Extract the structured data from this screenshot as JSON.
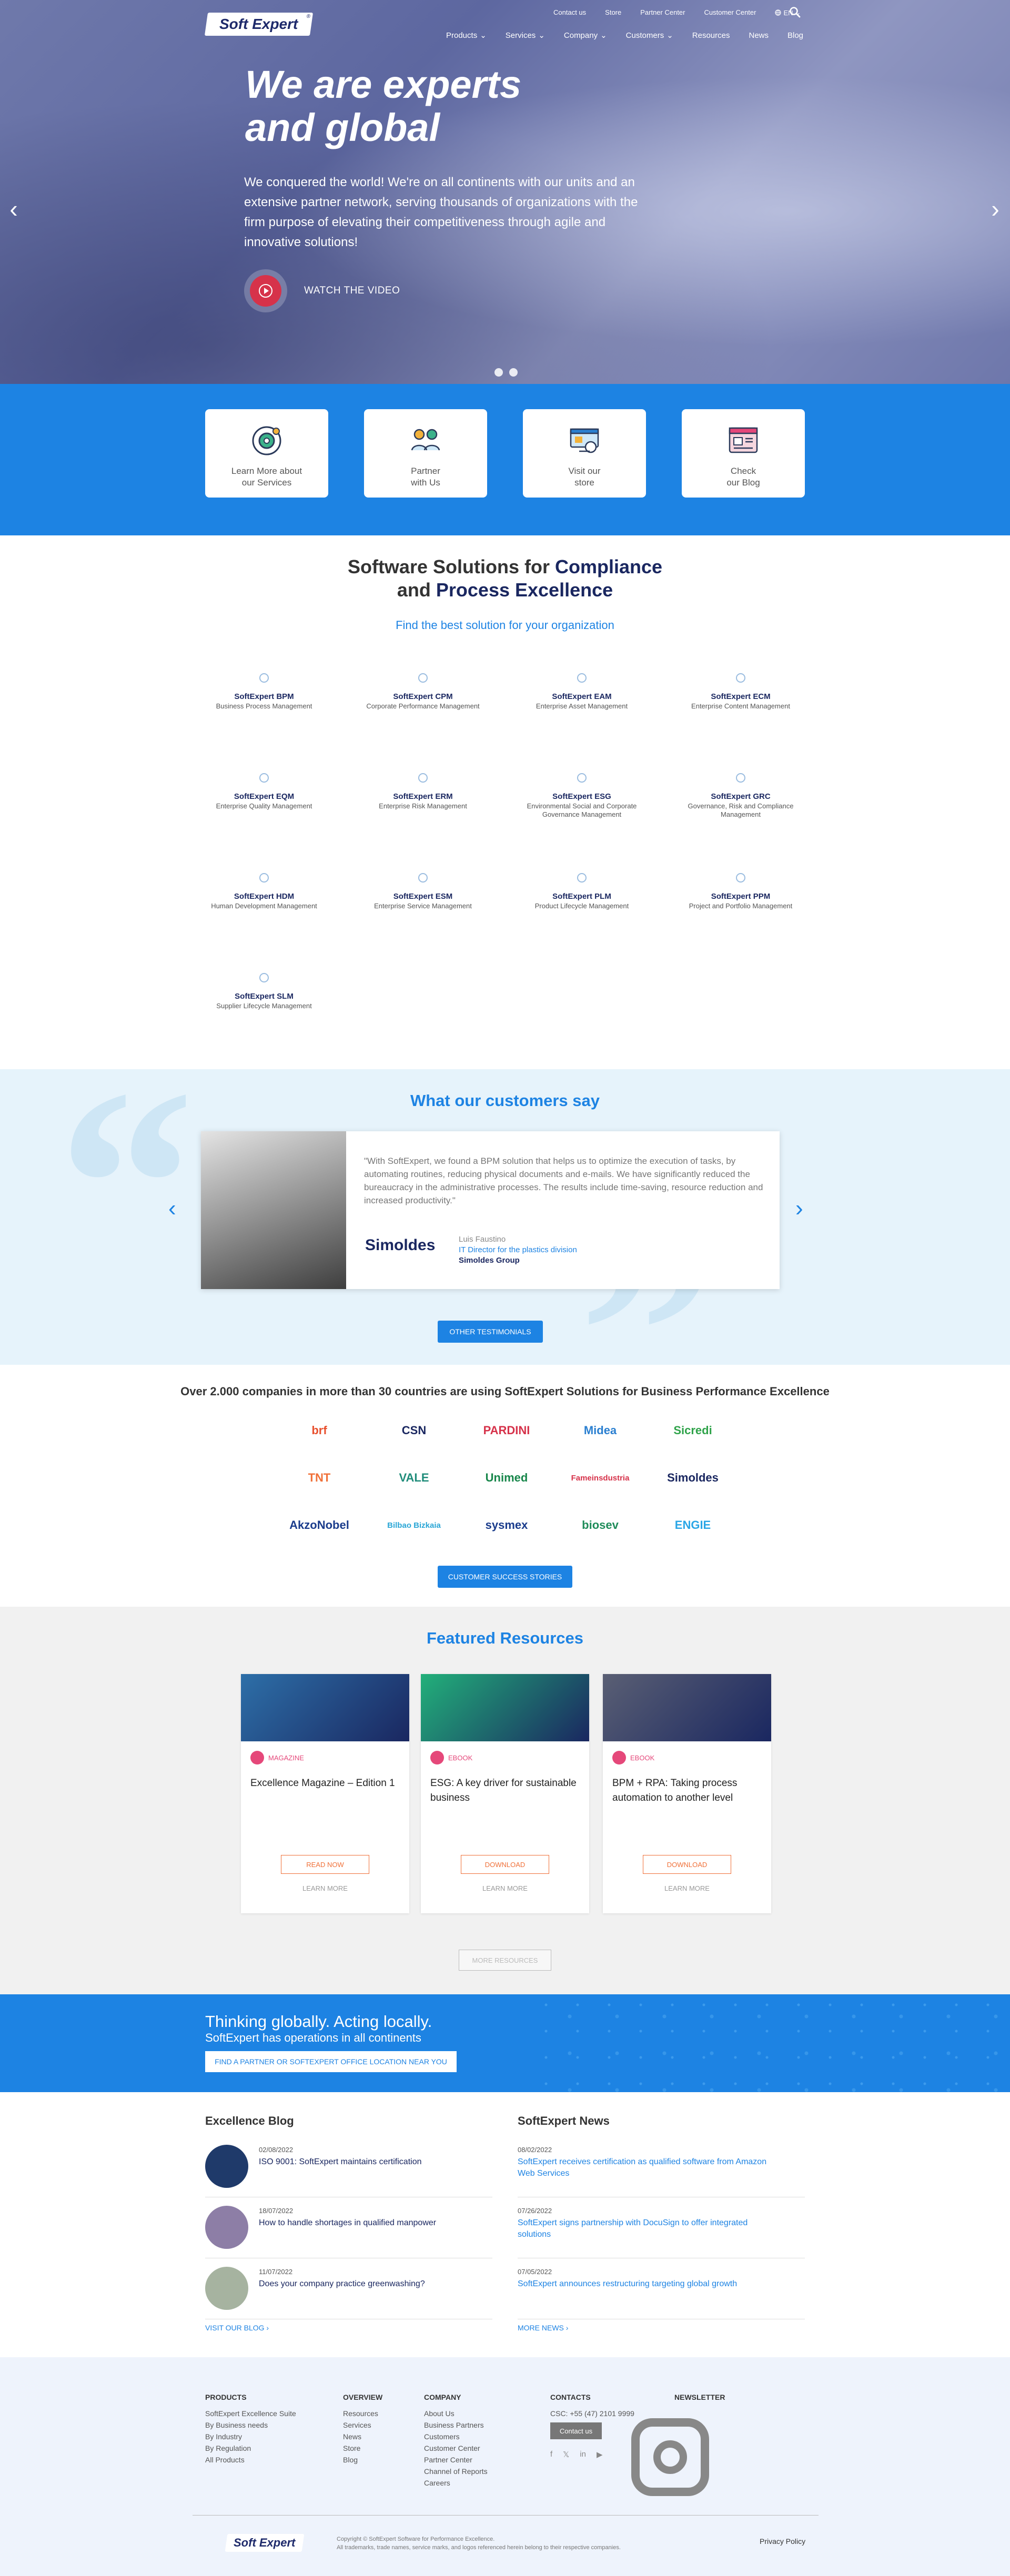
{
  "header": {
    "logo": "Soft Expert",
    "logo_mark": "®",
    "top_links": [
      "Contact us",
      "Store",
      "Partner Center",
      "Customer Center"
    ],
    "language": "EN",
    "nav": [
      {
        "label": "Products",
        "dropdown": true
      },
      {
        "label": "Services",
        "dropdown": true
      },
      {
        "label": "Company",
        "dropdown": true
      },
      {
        "label": "Customers",
        "dropdown": true
      },
      {
        "label": "Resources",
        "dropdown": false
      },
      {
        "label": "News",
        "dropdown": false
      },
      {
        "label": "Blog",
        "dropdown": false
      }
    ]
  },
  "hero": {
    "title_line1": "We are experts",
    "title_line2": "and global",
    "text": "We conquered the world! We're on all continents with our units and an extensive partner network, serving thousands of organizations with the firm purpose of elevating their competitiveness through agile and innovative solutions!",
    "video_label": "WATCH THE VIDEO",
    "slide_count": 2
  },
  "quick_links": [
    {
      "line1": "Learn More about",
      "line2": "our Services",
      "icon": "gear-icon"
    },
    {
      "line1": "Partner",
      "line2": "with Us",
      "icon": "partners-icon"
    },
    {
      "line1": "Visit our",
      "line2": "store",
      "icon": "store-icon"
    },
    {
      "line1": "Check",
      "line2": "our Blog",
      "icon": "blog-icon"
    }
  ],
  "solutions": {
    "title_prefix": "Software Solutions for",
    "title_bold1": "Compliance",
    "title_and": "and",
    "title_bold2": "Process Excellence",
    "subtitle": "Find the best solution for your organization",
    "products": [
      {
        "name": "SoftExpert BPM",
        "desc": "Business Process Management"
      },
      {
        "name": "SoftExpert CPM",
        "desc": "Corporate Performance Management"
      },
      {
        "name": "SoftExpert EAM",
        "desc": "Enterprise Asset Management"
      },
      {
        "name": "SoftExpert ECM",
        "desc": "Enterprise Content Management"
      },
      {
        "name": "SoftExpert EQM",
        "desc": "Enterprise Quality Management"
      },
      {
        "name": "SoftExpert ERM",
        "desc": "Enterprise Risk Management"
      },
      {
        "name": "SoftExpert ESG",
        "desc": "Environmental Social and Corporate Governance Management"
      },
      {
        "name": "SoftExpert GRC",
        "desc": "Governance, Risk and Compliance Management"
      },
      {
        "name": "SoftExpert HDM",
        "desc": "Human Development Management"
      },
      {
        "name": "SoftExpert ESM",
        "desc": "Enterprise Service Management"
      },
      {
        "name": "SoftExpert PLM",
        "desc": "Product Lifecycle Management"
      },
      {
        "name": "SoftExpert PPM",
        "desc": "Project and Portfolio Management"
      },
      {
        "name": "SoftExpert SLM",
        "desc": "Supplier Lifecycle Management"
      }
    ]
  },
  "testimonials": {
    "title": "What our customers say",
    "quote": "\"With SoftExpert, we found a BPM solution that helps us to optimize the execution of tasks, by automating routines, reducing physical documents and e-mails. We have significantly reduced the bureaucracy in the administrative processes. The results include time-saving, resource reduction and increased productivity.\"",
    "company_logo": "Simoldes",
    "person": "Luis Faustino",
    "role": "IT Director for the plastics division",
    "company": "Simoldes Group",
    "button": "OTHER TESTIMONIALS"
  },
  "companies": {
    "title": "Over 2.000 companies in more than 30 countries are using SoftExpert Solutions for Business Performance Excellence",
    "logos": [
      {
        "name": "brf",
        "color": "#e8502e"
      },
      {
        "name": "CSN",
        "color": "#1a2760"
      },
      {
        "name": "PARDINI",
        "color": "#d6324a"
      },
      {
        "name": "Midea",
        "color": "#2a7fd0"
      },
      {
        "name": "Sicredi",
        "color": "#2fa34a"
      },
      {
        "name": "TNT",
        "color": "#f07038"
      },
      {
        "name": "VALE",
        "color": "#1f8c7a"
      },
      {
        "name": "Unimed",
        "color": "#17864a"
      },
      {
        "name": "Fameinsdustria",
        "color": "#d6324a"
      },
      {
        "name": "Simoldes",
        "color": "#1a2760"
      },
      {
        "name": "AkzoNobel",
        "color": "#1a3c8c"
      },
      {
        "name": "Bilbao Bizkaia",
        "color": "#2aa6d6"
      },
      {
        "name": "sysmex",
        "color": "#1a3c8c"
      },
      {
        "name": "biosev",
        "color": "#1f8c5a"
      },
      {
        "name": "ENGIE",
        "color": "#2aa6e6"
      }
    ],
    "button": "CUSTOMER SUCCESS STORIES"
  },
  "resources": {
    "title": "Featured Resources",
    "cards": [
      {
        "type": "MAGAZINE",
        "title": "Excellence Magazine – Edition 1",
        "button": "READ NOW",
        "more": "LEARN MORE",
        "image_color": "#2d6fa8"
      },
      {
        "type": "EBOOK",
        "title": "ESG: A key driver for sustainable business",
        "button": "DOWNLOAD",
        "more": "LEARN MORE",
        "image_color": "#22b07a"
      },
      {
        "type": "EBOOK",
        "title": "BPM + RPA: Taking process automation to another level",
        "button": "DOWNLOAD",
        "more": "LEARN MORE",
        "image_color": "#5a5f74"
      }
    ],
    "more_button": "MORE RESOURCES"
  },
  "global": {
    "line1": "Thinking globally. Acting locally.",
    "line2": "SoftExpert has operations in all continents",
    "button": "FIND A PARTNER OR SOFTEXPERT OFFICE LOCATION NEAR YOU"
  },
  "blog": {
    "title": "Excellence Blog",
    "items": [
      {
        "date": "02/08/2022",
        "title": "ISO 9001: SoftExpert maintains certification",
        "thumb_color": "#1f3a6a"
      },
      {
        "date": "18/07/2022",
        "title": "How to handle shortages in qualified manpower",
        "thumb_color": "#8d7ea6"
      },
      {
        "date": "11/07/2022",
        "title": "Does your company practice greenwashing?",
        "thumb_color": "#a6b3a0"
      }
    ],
    "more": "VISIT OUR BLOG  ›"
  },
  "news": {
    "title": "SoftExpert News",
    "items": [
      {
        "date": "08/02/2022",
        "title": "SoftExpert receives certification as qualified software from Amazon Web Services"
      },
      {
        "date": "07/26/2022",
        "title": "SoftExpert signs partnership with DocuSign to offer integrated solutions"
      },
      {
        "date": "07/05/2022",
        "title": "SoftExpert announces restructuring targeting global growth"
      }
    ],
    "more": "MORE NEWS  ›"
  },
  "footer": {
    "products_title": "PRODUCTS",
    "products": [
      "SoftExpert Excellence Suite",
      "By Business needs",
      "By Industry",
      "By Regulation",
      "All Products"
    ],
    "overview_title": "OVERVIEW",
    "overview": [
      "Resources",
      "Services",
      "News",
      "Store",
      "Blog"
    ],
    "company_title": "COMPANY",
    "company": [
      "About Us",
      "Business Partners",
      "Customers",
      "Customer Center",
      "Partner Center",
      "Channel of Reports",
      "Careers"
    ],
    "contacts_title": "CONTACTS",
    "phone": "CSC: +55 (47) 2101 9999",
    "contact_button": "Contact us",
    "newsletter_title": "NEWSLETTER",
    "logo": "Soft Expert",
    "copyright1": "Copyright © SoftExpert Software for Performance Excellence.",
    "copyright2": "All trademarks, trade names, service marks, and logos referenced herein belong to their respective companies.",
    "privacy": "Privacy Policy"
  }
}
